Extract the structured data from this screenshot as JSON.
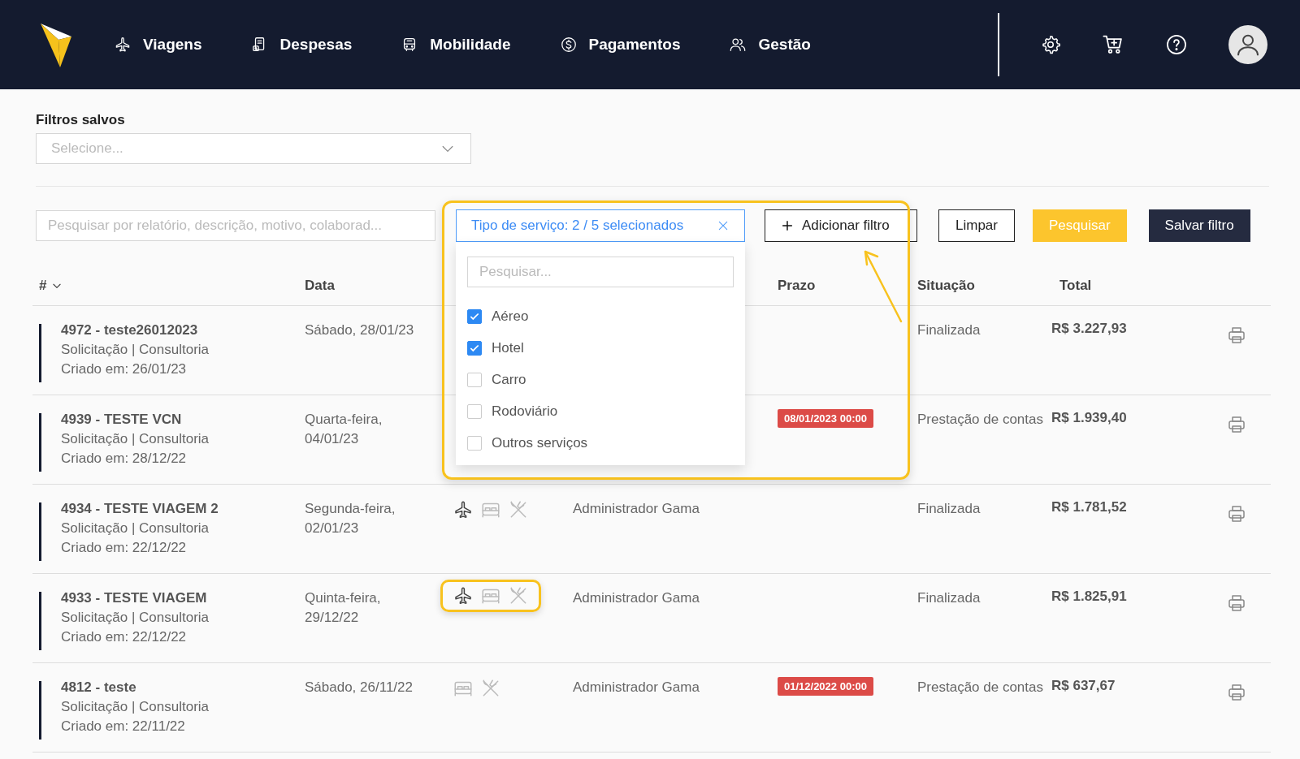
{
  "nav": {
    "items": [
      {
        "label": "Viagens"
      },
      {
        "label": "Despesas"
      },
      {
        "label": "Mobilidade"
      },
      {
        "label": "Pagamentos"
      },
      {
        "label": "Gestão"
      }
    ]
  },
  "saved_filters": {
    "label": "Filtros salvos",
    "placeholder": "Selecione..."
  },
  "search": {
    "placeholder": "Pesquisar por relatório, descrição, motivo, colaborad..."
  },
  "filter_chip": {
    "label": "Tipo de serviço: 2 / 5 selecionados"
  },
  "dropdown": {
    "placeholder": "Pesquisar...",
    "options": [
      {
        "label": "Aéreo",
        "checked": true
      },
      {
        "label": "Hotel",
        "checked": true
      },
      {
        "label": "Carro",
        "checked": false
      },
      {
        "label": "Rodoviário",
        "checked": false
      },
      {
        "label": "Outros serviços",
        "checked": false
      }
    ]
  },
  "buttons": [
    {
      "label": "Adicionar filtro",
      "kind": "add"
    },
    {
      "label": "Limpar",
      "kind": "outline"
    },
    {
      "label": "Pesquisar",
      "kind": "primary"
    },
    {
      "label": "Salvar filtro",
      "kind": "dark"
    }
  ],
  "columns": {
    "id": "#",
    "date": "Data",
    "deadline": "Prazo",
    "status": "Situação",
    "total": "Total"
  },
  "rows": [
    {
      "title": "4972 - teste26012023",
      "subtitle": "Solicitação | Consultoria",
      "created": "Criado em: 26/01/23",
      "date": "Sábado, 28/01/23",
      "status": "Finalizada",
      "total": "R$ 3.227,93"
    },
    {
      "title": "4939 - TESTE VCN",
      "subtitle": "Solicitação | Consultoria",
      "created": "Criado em: 28/12/22",
      "date": "Quarta-feira, 04/01/23",
      "deadline": "08/01/2023 00:00",
      "status": "Prestação de contas",
      "total": "R$ 1.939,40"
    },
    {
      "title": "4934 - TESTE VIAGEM 2",
      "subtitle": "Solicitação | Consultoria",
      "created": "Criado em: 22/12/22",
      "date": "Segunda-feira, 02/01/23",
      "highlighted": false,
      "services": [
        {
          "kind": "air",
          "active": true
        },
        {
          "kind": "hotel",
          "active": false
        },
        {
          "kind": "food",
          "active": false
        }
      ],
      "responsible": "Administrador Gama",
      "status": "Finalizada",
      "total": "R$ 1.781,52"
    },
    {
      "title": "4933 - TESTE VIAGEM",
      "subtitle": "Solicitação | Consultoria",
      "created": "Criado em: 22/12/22",
      "date": "Quinta-feira, 29/12/22",
      "highlighted": true,
      "services": [
        {
          "kind": "air",
          "active": true
        },
        {
          "kind": "hotel",
          "active": false
        },
        {
          "kind": "food",
          "active": false
        }
      ],
      "responsible": "Administrador Gama",
      "status": "Finalizada",
      "total": "R$ 1.825,91"
    },
    {
      "title": "4812 - teste",
      "subtitle": "Solicitação | Consultoria",
      "created": "Criado em: 22/11/22",
      "date": "Sábado, 26/11/22",
      "highlighted": false,
      "services": [
        {
          "kind": "hotel",
          "active": false
        },
        {
          "kind": "food",
          "active": false
        }
      ],
      "responsible": "Administrador Gama",
      "deadline": "01/12/2022 00:00",
      "status": "Prestação de contas",
      "total": "R$ 637,67"
    }
  ]
}
